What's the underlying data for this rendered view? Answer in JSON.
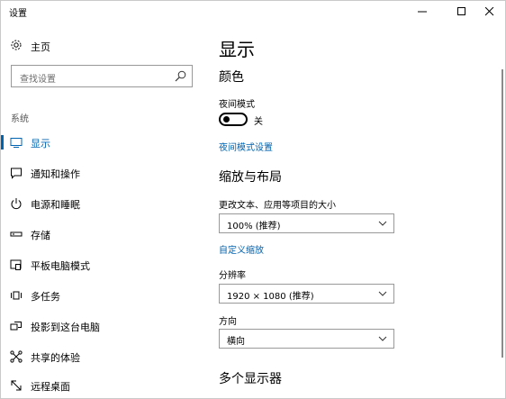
{
  "window": {
    "title": "设置"
  },
  "sidebar": {
    "home_label": "主页",
    "search_placeholder": "查找设置",
    "section_label": "系统",
    "items": [
      {
        "label": "显示",
        "icon": "monitor-icon",
        "selected": true
      },
      {
        "label": "通知和操作",
        "icon": "notification-icon",
        "selected": false
      },
      {
        "label": "电源和睡眠",
        "icon": "power-icon",
        "selected": false
      },
      {
        "label": "存储",
        "icon": "storage-icon",
        "selected": false
      },
      {
        "label": "平板电脑模式",
        "icon": "tablet-mode-icon",
        "selected": false
      },
      {
        "label": "多任务",
        "icon": "multitasking-icon",
        "selected": false
      },
      {
        "label": "投影到这台电脑",
        "icon": "projecting-icon",
        "selected": false
      },
      {
        "label": "共享的体验",
        "icon": "shared-experiences-icon",
        "selected": false
      },
      {
        "label": "远程桌面",
        "icon": "remote-desktop-icon",
        "selected": false
      }
    ]
  },
  "main": {
    "title": "显示",
    "color_heading": "颜色",
    "night_mode_label": "夜间模式",
    "night_mode_state": "关",
    "night_mode_link": "夜间模式设置",
    "scale_heading": "缩放与布局",
    "scale_label": "更改文本、应用等项目的大小",
    "scale_value": "100% (推荐)",
    "custom_scale_link": "自定义缩放",
    "resolution_label": "分辨率",
    "resolution_value": "1920 × 1080 (推荐)",
    "orientation_label": "方向",
    "orientation_value": "横向",
    "multi_display_heading": "多个显示器"
  },
  "colors": {
    "accent": "#0063b1"
  }
}
